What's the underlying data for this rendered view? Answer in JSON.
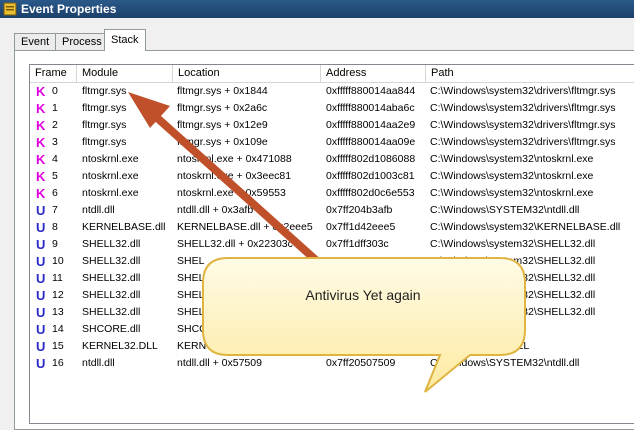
{
  "window": {
    "title": "Event Properties",
    "icon": "event-properties-icon"
  },
  "tabs": [
    {
      "label": "Event",
      "active": false
    },
    {
      "label": "Process",
      "active": false
    },
    {
      "label": "Stack",
      "active": true
    }
  ],
  "columns": [
    "Frame",
    "Module",
    "Location",
    "Address",
    "Path"
  ],
  "rows": [
    {
      "mode": "K",
      "frame": "0",
      "module": "fltmgr.sys",
      "location": "fltmgr.sys + 0x1844",
      "address": "0xfffff880014aa844",
      "path": "C:\\Windows\\system32\\drivers\\fltmgr.sys"
    },
    {
      "mode": "K",
      "frame": "1",
      "module": "fltmgr.sys",
      "location": "fltmgr.sys + 0x2a6c",
      "address": "0xfffff880014aba6c",
      "path": "C:\\Windows\\system32\\drivers\\fltmgr.sys"
    },
    {
      "mode": "K",
      "frame": "2",
      "module": "fltmgr.sys",
      "location": "fltmgr.sys + 0x12e9",
      "address": "0xfffff880014aa2e9",
      "path": "C:\\Windows\\system32\\drivers\\fltmgr.sys"
    },
    {
      "mode": "K",
      "frame": "3",
      "module": "fltmgr.sys",
      "location": "fltmgr.sys + 0x109e",
      "address": "0xfffff880014aa09e",
      "path": "C:\\Windows\\system32\\drivers\\fltmgr.sys"
    },
    {
      "mode": "K",
      "frame": "4",
      "module": "ntoskrnl.exe",
      "location": "ntoskrnl.exe + 0x471088",
      "address": "0xfffff802d1086088",
      "path": "C:\\Windows\\system32\\ntoskrnl.exe"
    },
    {
      "mode": "K",
      "frame": "5",
      "module": "ntoskrnl.exe",
      "location": "ntoskrnl.exe + 0x3eec81",
      "address": "0xfffff802d1003c81",
      "path": "C:\\Windows\\system32\\ntoskrnl.exe"
    },
    {
      "mode": "K",
      "frame": "6",
      "module": "ntoskrnl.exe",
      "location": "ntoskrnl.exe + 0x59553",
      "address": "0xfffff802d0c6e553",
      "path": "C:\\Windows\\system32\\ntoskrnl.exe"
    },
    {
      "mode": "U",
      "frame": "7",
      "module": "ntdll.dll",
      "location": "ntdll.dll + 0x3afb",
      "address": "0x7ff204b3afb",
      "path": "C:\\Windows\\SYSTEM32\\ntdll.dll"
    },
    {
      "mode": "U",
      "frame": "8",
      "module": "KERNELBASE.dll",
      "location": "KERNELBASE.dll + 0x2eee5",
      "address": "0x7ff1d42eee5",
      "path": "C:\\Windows\\system32\\KERNELBASE.dll"
    },
    {
      "mode": "U",
      "frame": "9",
      "module": "SHELL32.dll",
      "location": "SHELL32.dll + 0x22303c",
      "address": "0x7ff1dff303c",
      "path": "C:\\Windows\\system32\\SHELL32.dll"
    },
    {
      "mode": "U",
      "frame": "10",
      "module": "SHELL32.dll",
      "location": "SHEL",
      "address": "",
      "path": "C:\\Windows\\system32\\SHELL32.dll"
    },
    {
      "mode": "U",
      "frame": "11",
      "module": "SHELL32.dll",
      "location": "SHEL",
      "address": "",
      "path": "C:\\Windows\\system32\\SHELL32.dll"
    },
    {
      "mode": "U",
      "frame": "12",
      "module": "SHELL32.dll",
      "location": "SHEL",
      "address": "",
      "path": "C:\\Windows\\system32\\SHELL32.dll"
    },
    {
      "mode": "U",
      "frame": "13",
      "module": "SHELL32.dll",
      "location": "SHEL",
      "address": "",
      "path": "C:\\Windows\\system32\\SHELL32.dll"
    },
    {
      "mode": "U",
      "frame": "14",
      "module": "SHCORE.dll",
      "location": "SHCO",
      "address": "",
      "path": "M32\\SHCORE.dll"
    },
    {
      "mode": "U",
      "frame": "15",
      "module": "KERNEL32.DLL",
      "location": "KERN",
      "address": "",
      "path": "M32\\KERNEL32.DLL"
    },
    {
      "mode": "U",
      "frame": "16",
      "module": "ntdll.dll",
      "location": "ntdll.dll + 0x57509",
      "address": "0x7ff20507509",
      "path": "C:\\Windows\\SYSTEM32\\ntdll.dll"
    }
  ],
  "annotation": {
    "text": "Antivirus Yet again",
    "arrow_color": "#c0502a",
    "bubble_color": "#fff6c8"
  },
  "colors": {
    "kernel_mode": "#e000e0",
    "user_mode": "#2a2ac8",
    "titlebar": "#1c3f6a"
  }
}
